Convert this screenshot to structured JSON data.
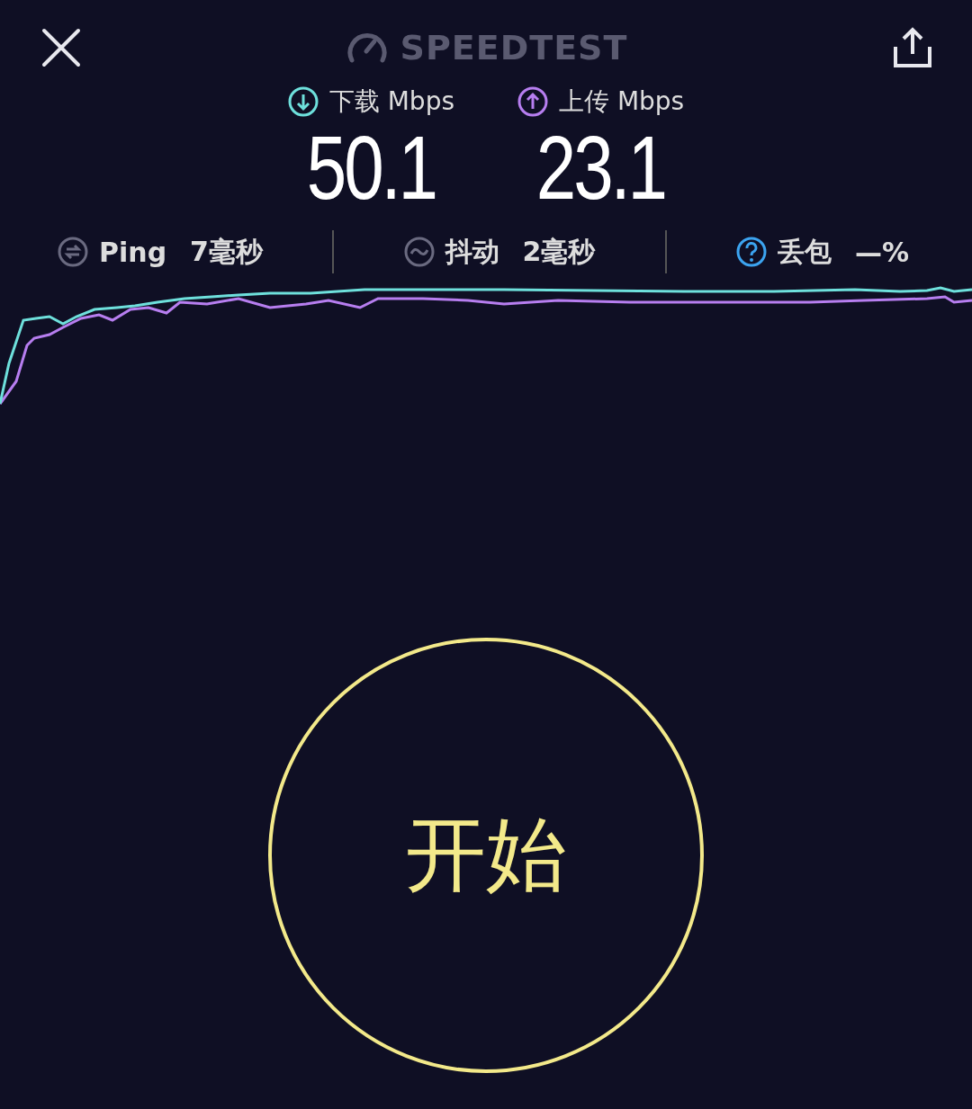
{
  "header": {
    "title": "SPEEDTEST"
  },
  "metrics": [
    {
      "kind": "download",
      "label": "下载 Mbps",
      "value": "50.1",
      "color": "#6ee0dc"
    },
    {
      "kind": "upload",
      "label": "上传 Mbps",
      "value": "23.1",
      "color": "#b77ef0"
    }
  ],
  "stats": [
    {
      "kind": "ping",
      "label": "Ping",
      "value": "7毫秒"
    },
    {
      "kind": "jitter",
      "label": "抖动",
      "value": "2毫秒"
    },
    {
      "kind": "loss",
      "label": "丢包",
      "value": "—%"
    }
  ],
  "start_button": {
    "label": "开始"
  }
}
